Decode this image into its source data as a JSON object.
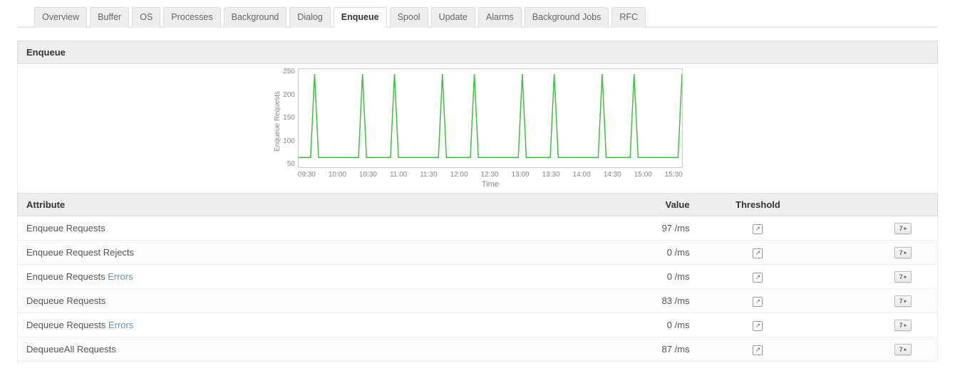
{
  "tabs": [
    {
      "label": "Overview",
      "active": false
    },
    {
      "label": "Buffer",
      "active": false
    },
    {
      "label": "OS",
      "active": false
    },
    {
      "label": "Processes",
      "active": false
    },
    {
      "label": "Background",
      "active": false
    },
    {
      "label": "Dialog",
      "active": false
    },
    {
      "label": "Enqueue",
      "active": true
    },
    {
      "label": "Spool",
      "active": false
    },
    {
      "label": "Update",
      "active": false
    },
    {
      "label": "Alarms",
      "active": false
    },
    {
      "label": "Background Jobs",
      "active": false
    },
    {
      "label": "RFC",
      "active": false
    }
  ],
  "panel_title": "Enqueue",
  "chart_data": {
    "type": "line",
    "title": "",
    "ylabel": "Enqueue Requests",
    "xlabel": "Time",
    "ylim": [
      50,
      250
    ],
    "y_ticks": [
      "250",
      "200",
      "150",
      "100",
      "50"
    ],
    "x_ticks": [
      "09:30",
      "10:00",
      "10:30",
      "11:00",
      "11:30",
      "12:00",
      "12:30",
      "13:00",
      "13:30",
      "14:00",
      "14:30",
      "15:00",
      "15:30"
    ],
    "series": [
      {
        "name": "Enqueue Requests",
        "color": "#3fbf3f",
        "x": [
          "09:30",
          "09:45",
          "10:00",
          "10:15",
          "10:30",
          "10:45",
          "11:00",
          "11:15",
          "11:30",
          "11:45",
          "12:00",
          "12:15",
          "12:30",
          "12:45",
          "13:00",
          "13:15",
          "13:30",
          "13:45",
          "14:00",
          "14:15",
          "14:30",
          "14:45",
          "15:00",
          "15:15",
          "15:30"
        ],
        "values": [
          70,
          240,
          70,
          70,
          240,
          70,
          240,
          70,
          70,
          240,
          70,
          240,
          70,
          70,
          240,
          70,
          240,
          70,
          70,
          240,
          70,
          240,
          70,
          70,
          240
        ]
      }
    ]
  },
  "table": {
    "headers": {
      "attribute": "Attribute",
      "value": "Value",
      "threshold": "Threshold"
    },
    "rows": [
      {
        "attribute": "Enqueue Requests",
        "value": "97 /ms"
      },
      {
        "attribute": "Enqueue Request Rejects",
        "value": "0 /ms"
      },
      {
        "attribute_pre": "Enqueue Requests ",
        "attribute_link": "Errors",
        "value": "0 /ms"
      },
      {
        "attribute": "Dequeue Requests",
        "value": "83 /ms"
      },
      {
        "attribute_pre": "Dequeue Requests ",
        "attribute_link": "Errors",
        "value": "0 /ms"
      },
      {
        "attribute": "DequeueAll Requests",
        "value": "87 /ms"
      }
    ]
  }
}
